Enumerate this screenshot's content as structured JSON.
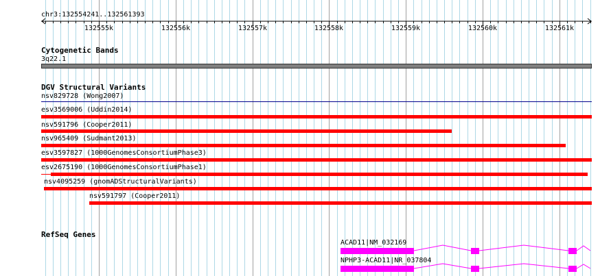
{
  "ruler": {
    "location": "chr3:132554241..132561393",
    "ticks": [
      "132555k",
      "132556k",
      "132557k",
      "132558k",
      "132559k",
      "132560k",
      "132561k"
    ]
  },
  "cytoband": {
    "title": "Cytogenetic Bands",
    "band": "3q22.1"
  },
  "dgv": {
    "title": "DGV Structural Variants",
    "variants": [
      {
        "label": "nsv829728 (Wong2007)",
        "color": "#00008b"
      },
      {
        "label": "esv3569006 (Uddin2014)",
        "color": "#ff0000"
      },
      {
        "label": "nsv591796 (Cooper2011)",
        "color": "#ff0000"
      },
      {
        "label": "nsv965409 (Sudmant2013)",
        "color": "#ff0000"
      },
      {
        "label": "esv3597827 (1000GenomesConsortiumPhase3)",
        "color": "#ff0000"
      },
      {
        "label": "esv2675190 (1000GenomesConsortiumPhase1)",
        "color": "#ff0000"
      },
      {
        "label": "nsv4095259 (gnomADStructuralVariants)",
        "color": "#ff0000"
      },
      {
        "label": "nsv591797 (Cooper2011)",
        "color": "#ff0000"
      }
    ]
  },
  "refseq": {
    "title": "RefSeq Genes",
    "genes": [
      {
        "label": "ACAD11|NM_032169",
        "color": "#ff00ff"
      },
      {
        "label": "NPHP3-ACAD11|NR_037804",
        "color": "#ff00ff"
      }
    ]
  },
  "colors": {
    "grid_major": "#a0a0a0",
    "grid_minor": "#add8e6",
    "cytoband_fill": "#808080",
    "variant": "#ff0000",
    "gene": "#ff00ff"
  }
}
